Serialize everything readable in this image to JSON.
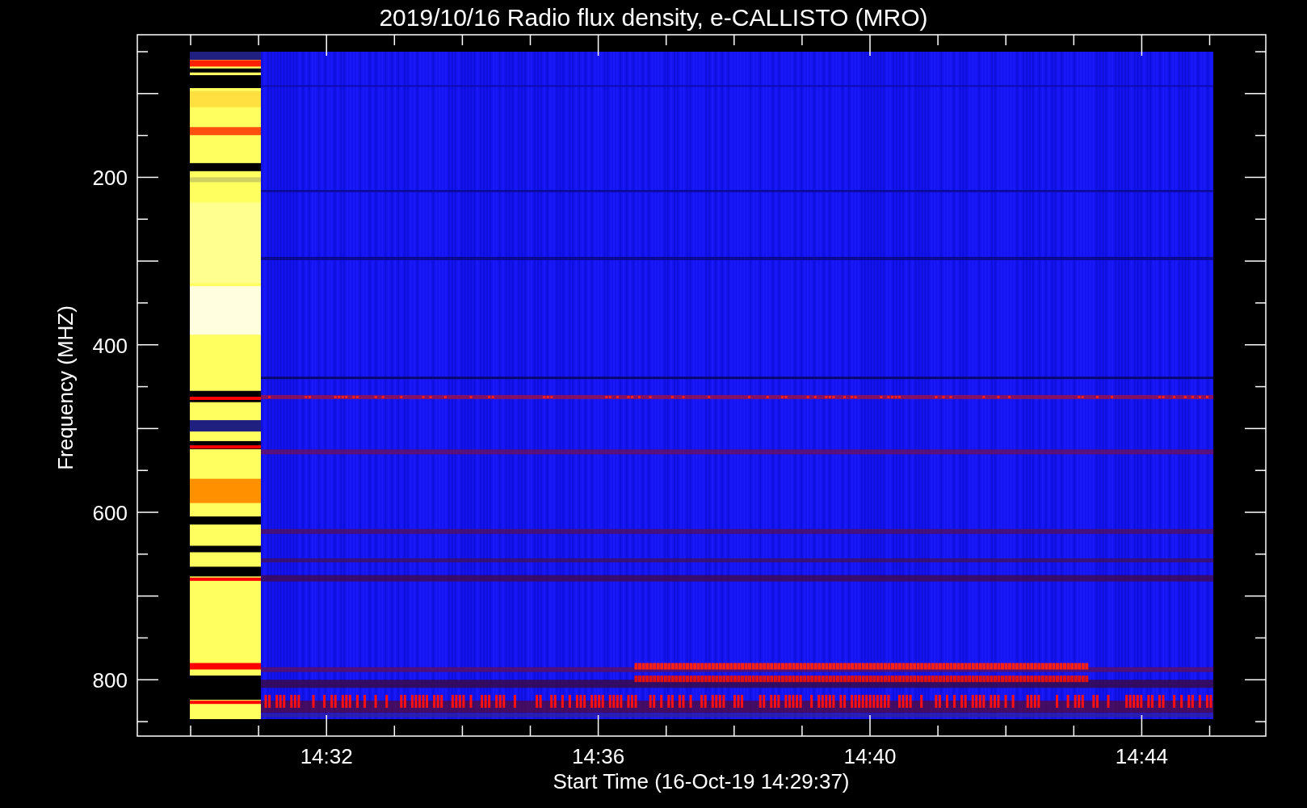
{
  "chart": {
    "title": "2019/10/16  Radio flux density, e-CALLISTO (MRO)",
    "ylabel": "Frequency (MHZ)",
    "xlabel": "Start Time (16-Oct-19 14:29:37)",
    "y_tick_labels": [
      "200",
      "400",
      "600",
      "800"
    ],
    "x_tick_labels": [
      "14:32",
      "14:36",
      "14:40",
      "14:44"
    ]
  }
}
